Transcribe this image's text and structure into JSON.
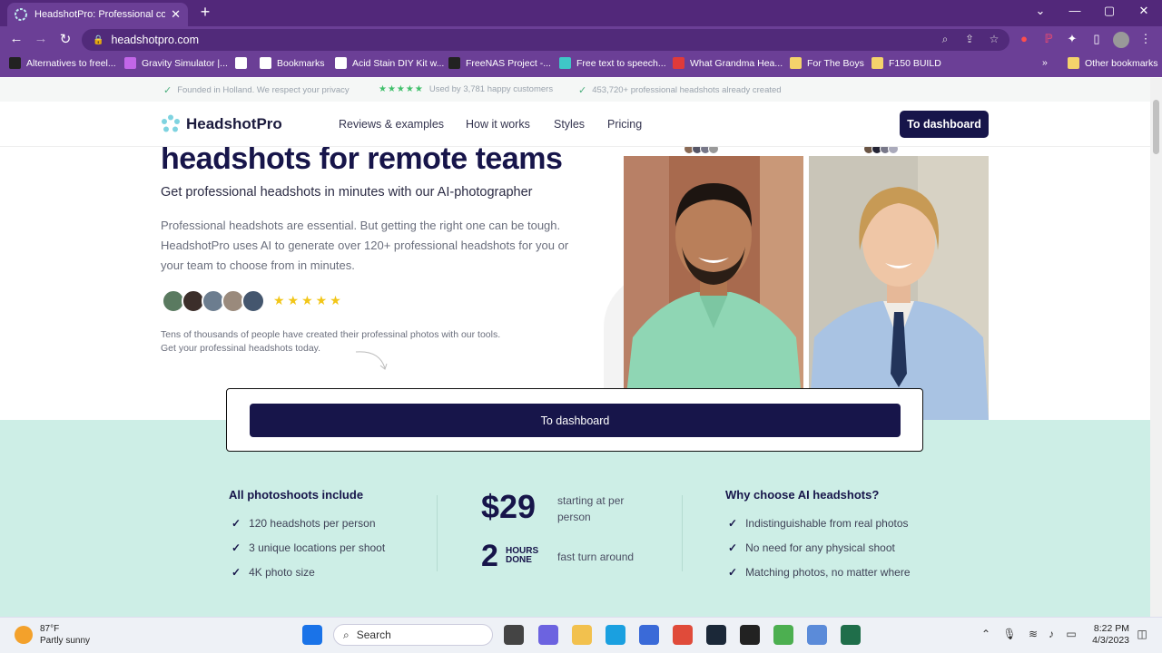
{
  "browser": {
    "tab_title": "HeadshotPro: Professional corpo",
    "url": "headshotpro.com",
    "bookmarks": [
      {
        "label": "Alternatives to freel...",
        "color": "#222222"
      },
      {
        "label": "Gravity Simulator |...",
        "color": "#c266e8"
      },
      {
        "label": "",
        "color": "#ffffff"
      },
      {
        "label": "Bookmarks",
        "color": "#ffffff"
      },
      {
        "label": "Acid Stain DIY Kit w...",
        "color": "#ffffff"
      },
      {
        "label": "FreeNAS Project -...",
        "color": "#222222"
      },
      {
        "label": "Free text to speech...",
        "color": "#3fc7c7"
      },
      {
        "label": "What Grandma Hea...",
        "color": "#e03a3a"
      },
      {
        "label": "For The Boys",
        "color": "#f4d36b"
      },
      {
        "label": "F150 BUILD",
        "color": "#f4d36b"
      }
    ],
    "more_bookmarks": "»",
    "other_bookmarks": "Other bookmarks"
  },
  "trust_bar": {
    "item1": "Founded in Holland. We respect your privacy",
    "stars": "★★★★★",
    "item2": "Used by 3,781 happy customers",
    "item3": "453,720+ professional headshots already created"
  },
  "header": {
    "logo_text": "HeadshotPro",
    "nav": [
      "Reviews & examples",
      "How it works",
      "Styles",
      "Pricing"
    ],
    "dashboard_button": "To dashboard"
  },
  "hero": {
    "title": "headshots for remote teams",
    "subtitle": "Get professional headshots in minutes with our AI-photographer",
    "description": "Professional headshots are essential. But getting the right one can be tough. HeadshotPro uses AI to generate over 120+ professional headshots for you or your team to choose from in minutes.",
    "rating_stars": "★★★★★",
    "social_proof": "Tens of thousands of people have created their professinal photos with our tools. Get your professinal headshots today."
  },
  "cta": {
    "button": "To dashboard"
  },
  "features": {
    "left_heading": "All photoshoots include",
    "left_items": [
      "120 headshots per person",
      "3 unique locations per shoot",
      "4K photo size"
    ],
    "price": "$29",
    "price_label": "starting at per person",
    "turnaround_number": "2",
    "turnaround_unit": "HOURS DONE",
    "turnaround_label": "fast turn around",
    "right_heading": "Why choose AI headshots?",
    "right_items": [
      "Indistinguishable from real photos",
      "No need for any physical shoot",
      "Matching photos, no matter where"
    ]
  },
  "taskbar": {
    "temp": "87°F",
    "weather": "Partly sunny",
    "search": "Search",
    "time": "8:22 PM",
    "date": "4/3/2023"
  }
}
